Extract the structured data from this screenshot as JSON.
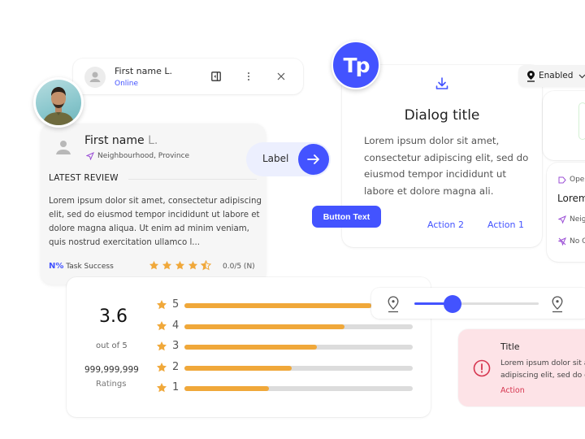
{
  "chat_header": {
    "name": "First name L.",
    "status": "Online",
    "icons": [
      "avatar-placeholder-icon",
      "side-panel-icon",
      "more-vertical-icon",
      "close-icon"
    ]
  },
  "review_card": {
    "first_name": "First name",
    "initial": "L.",
    "location": "Neighbourhood, Province",
    "section_title": "LATEST REVIEW",
    "review_text": "Lorem ipsum dolor sit amet, consectetur adipiscing elit, sed do eiusmod tempor incididunt ut labore et dolore magna aliqua. Ut enim ad minim veniam, quis nostrud exercitation ullamco l...",
    "metric_value": "N%",
    "metric_label": "Task Success",
    "stars_filled": 4.5,
    "stars_total": 5,
    "rating_text": "0.0/5 (N)"
  },
  "label_chip": {
    "label": "Label",
    "icon": "arrow-right-icon"
  },
  "primary_button": {
    "label": "Button Text"
  },
  "logo": {
    "text": "Tp"
  },
  "dialog": {
    "icon": "download-icon",
    "title": "Dialog title",
    "body": "Lorem ipsum dolor sit amet, consectetur adipiscing elit, sed do eiusmod tempor incididunt ut labore et dolore magna ali.",
    "action_secondary": "Action 2",
    "action_primary": "Action 1"
  },
  "location_dropdown": {
    "icon": "location-pin-icon",
    "value": "Enabled"
  },
  "place_card": {
    "status": "Ope",
    "title": "Lorem",
    "location": "Neig",
    "note": "No C"
  },
  "ratings_summary": {
    "average": "3.6",
    "out_of": "out of 5",
    "count": "999,999,999",
    "count_label": "Ratings",
    "bars": [
      {
        "stars": "5",
        "fraction": 0.82
      },
      {
        "stars": "4",
        "fraction": 0.7
      },
      {
        "stars": "3",
        "fraction": 0.58
      },
      {
        "stars": "2",
        "fraction": 0.47
      },
      {
        "stars": "1",
        "fraction": 0.37
      }
    ]
  },
  "slider": {
    "value_fraction": 0.31,
    "start_icon": "location-pin-icon",
    "end_icon": "location-pin-icon"
  },
  "alert": {
    "title": "Title",
    "body_line1": "Lorem ipsum dolor sit a",
    "body_line2": "adipiscing elit, sed do e",
    "action": "Action",
    "icon": "error-icon"
  },
  "colors": {
    "primary": "#4353ff",
    "star": "#f0a83a",
    "error": "#d6354f",
    "error_bg": "#fde3e7",
    "chip_bg": "#eceffe"
  }
}
